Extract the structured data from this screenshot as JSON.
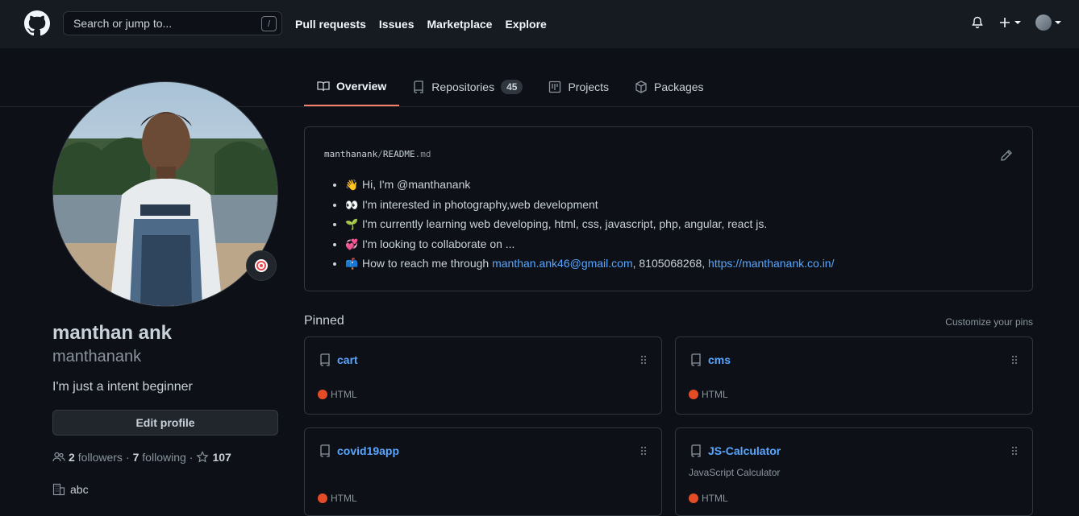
{
  "header": {
    "search_placeholder": "Search or jump to...",
    "search_key": "/",
    "nav": [
      "Pull requests",
      "Issues",
      "Marketplace",
      "Explore"
    ]
  },
  "tabs": [
    {
      "label": "Overview",
      "icon": "book-icon",
      "active": true
    },
    {
      "label": "Repositories",
      "icon": "repo-icon",
      "count": "45"
    },
    {
      "label": "Projects",
      "icon": "project-icon"
    },
    {
      "label": "Packages",
      "icon": "package-icon"
    }
  ],
  "profile": {
    "name": "manthan ank",
    "login": "manthanank",
    "bio": "I'm just a intent beginner",
    "edit_label": "Edit profile",
    "followers_count": "2",
    "followers_label": "followers",
    "following_count": "7",
    "following_label": "following",
    "stars": "107",
    "org": "abc",
    "separator": "·"
  },
  "readme": {
    "owner": "manthanank",
    "slash": "/",
    "file": "README",
    "ext": ".md",
    "items": [
      {
        "emoji": "👋",
        "text": "Hi, I'm @manthanank"
      },
      {
        "emoji": "👀",
        "text": "I'm interested in photography,web development"
      },
      {
        "emoji": "🌱",
        "text": "I'm currently learning web developing, html, css, javascript, php, angular, react js."
      },
      {
        "emoji": "💞",
        "text": "I'm looking to collaborate on ..."
      }
    ],
    "contact": {
      "emoji": "📫",
      "prefix": "How to reach me through ",
      "email": "manthan.ank46@gmail.com",
      "middle": ", 8105068268, ",
      "url": "https://manthanank.co.in/"
    }
  },
  "pinned": {
    "title": "Pinned",
    "customize": "Customize your pins",
    "repos": [
      {
        "name": "cart",
        "desc": "",
        "lang": "HTML"
      },
      {
        "name": "cms",
        "desc": "",
        "lang": "HTML"
      },
      {
        "name": "covid19app",
        "desc": "",
        "lang": "HTML"
      },
      {
        "name": "JS-Calculator",
        "desc": "JavaScript Calculator",
        "lang": "HTML"
      }
    ],
    "lang_color": "#e34c26"
  }
}
